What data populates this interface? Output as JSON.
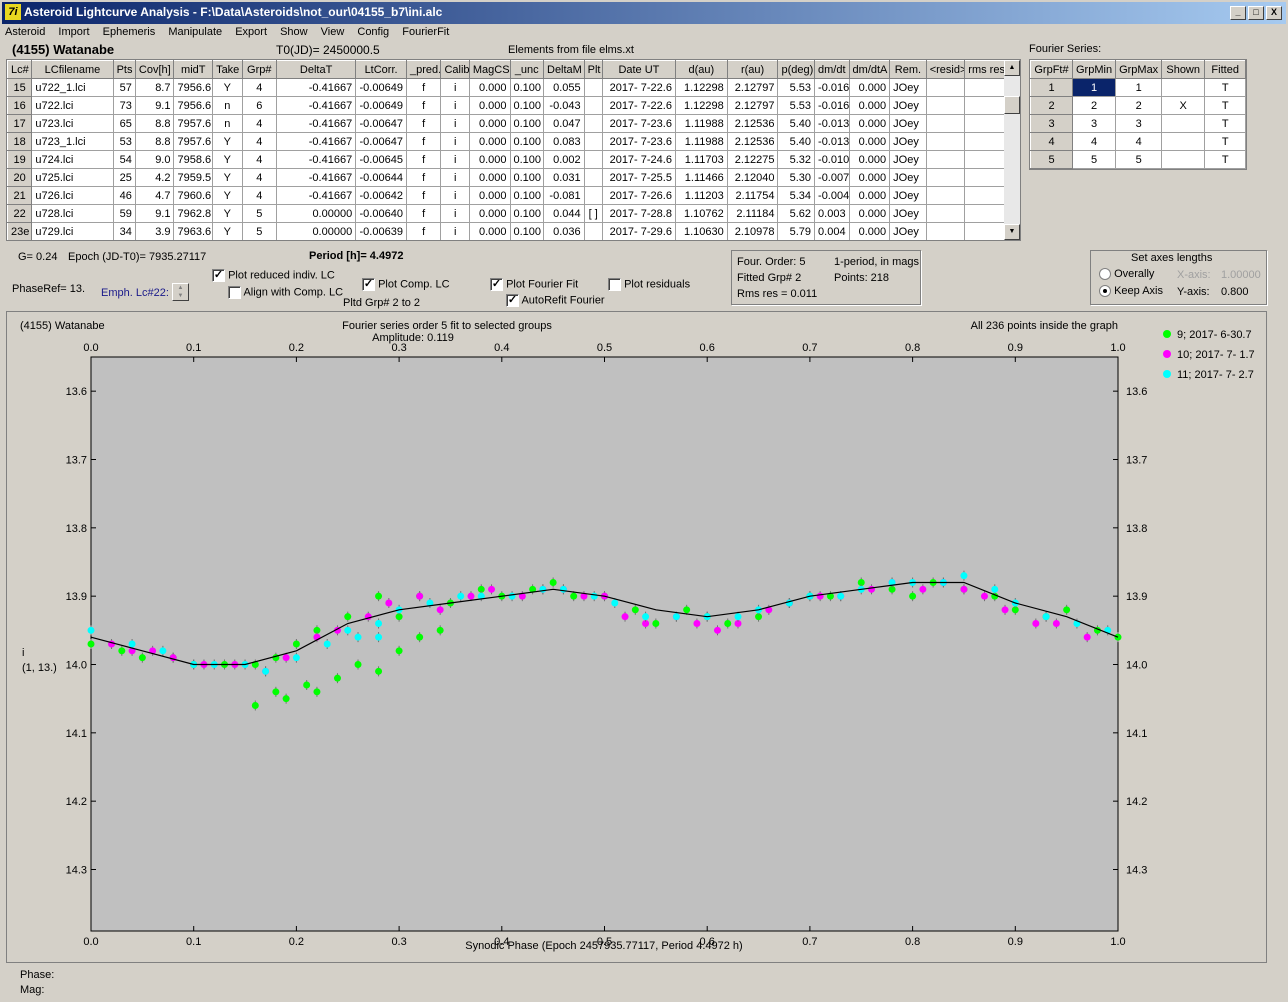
{
  "window": {
    "title": "Asteroid Lightcurve Analysis - F:\\Data\\Asteroids\\not_our\\04155_b7\\ini.alc",
    "icon_text": "7i",
    "min": "_",
    "max": "□",
    "close": "X"
  },
  "menu": [
    "Asteroid",
    "Import",
    "Ephemeris",
    "Manipulate",
    "Export",
    "Show",
    "View",
    "Config",
    "FourierFit"
  ],
  "header": {
    "object": "(4155) Watanabe",
    "t0": "T0(JD)= 2450000.5",
    "elements": "Elements from file elms.xt"
  },
  "lc_table": {
    "columns": [
      "Lc#",
      "LCfilename",
      "Pts",
      "Cov[h]",
      "midT",
      "Take",
      "Grp#",
      "DeltaT",
      "LtCorr.",
      "_pred.",
      "Calib",
      "MagCS",
      "_unc",
      "DeltaM",
      "Plt",
      "Date UT",
      "d(au)",
      "r(au)",
      "p(deg)",
      "dm/dt",
      "dm/dtA",
      "Rem.",
      "<resid>",
      "rms res"
    ],
    "rows": [
      [
        "15",
        "u722_1.lci",
        "57",
        "8.7",
        "7956.6",
        "Y",
        "4",
        "-0.41667",
        "-0.00649",
        "f",
        "i",
        "0.000",
        "0.100",
        "0.055",
        "",
        "2017- 7-22.6",
        "1.12298",
        "2.12797",
        "5.53",
        "-0.016",
        "0.000",
        "JOey",
        "",
        ""
      ],
      [
        "16",
        "u722.lci",
        "73",
        "9.1",
        "7956.6",
        "n",
        "6",
        "-0.41667",
        "-0.00649",
        "f",
        "i",
        "0.000",
        "0.100",
        "-0.043",
        "",
        "2017- 7-22.6",
        "1.12298",
        "2.12797",
        "5.53",
        "-0.016",
        "0.000",
        "JOey",
        "",
        ""
      ],
      [
        "17",
        "u723.lci",
        "65",
        "8.8",
        "7957.6",
        "n",
        "4",
        "-0.41667",
        "-0.00647",
        "f",
        "i",
        "0.000",
        "0.100",
        "0.047",
        "",
        "2017- 7-23.6",
        "1.11988",
        "2.12536",
        "5.40",
        "-0.013",
        "0.000",
        "JOey",
        "",
        ""
      ],
      [
        "18",
        "u723_1.lci",
        "53",
        "8.8",
        "7957.6",
        "Y",
        "4",
        "-0.41667",
        "-0.00647",
        "f",
        "i",
        "0.000",
        "0.100",
        "0.083",
        "",
        "2017- 7-23.6",
        "1.11988",
        "2.12536",
        "5.40",
        "-0.013",
        "0.000",
        "JOey",
        "",
        ""
      ],
      [
        "19",
        "u724.lci",
        "54",
        "9.0",
        "7958.6",
        "Y",
        "4",
        "-0.41667",
        "-0.00645",
        "f",
        "i",
        "0.000",
        "0.100",
        "0.002",
        "",
        "2017- 7-24.6",
        "1.11703",
        "2.12275",
        "5.32",
        "-0.010",
        "0.000",
        "JOey",
        "",
        ""
      ],
      [
        "20",
        "u725.lci",
        "25",
        "4.2",
        "7959.5",
        "Y",
        "4",
        "-0.41667",
        "-0.00644",
        "f",
        "i",
        "0.000",
        "0.100",
        "0.031",
        "",
        "2017- 7-25.5",
        "1.11466",
        "2.12040",
        "5.30",
        "-0.007",
        "0.000",
        "JOey",
        "",
        ""
      ],
      [
        "21",
        "u726.lci",
        "46",
        "4.7",
        "7960.6",
        "Y",
        "4",
        "-0.41667",
        "-0.00642",
        "f",
        "i",
        "0.000",
        "0.100",
        "-0.081",
        "",
        "2017- 7-26.6",
        "1.11203",
        "2.11754",
        "5.34",
        "-0.004",
        "0.000",
        "JOey",
        "",
        ""
      ],
      [
        "22",
        "u728.lci",
        "59",
        "9.1",
        "7962.8",
        "Y",
        "5",
        "0.00000",
        "-0.00640",
        "f",
        "i",
        "0.000",
        "0.100",
        "0.044",
        "[ ]",
        "2017- 7-28.8",
        "1.10762",
        "2.11184",
        "5.62",
        "0.003",
        "0.000",
        "JOey",
        "",
        ""
      ],
      [
        "23e",
        "u729.lci",
        "34",
        "3.9",
        "7963.6",
        "Y",
        "5",
        "0.00000",
        "-0.00639",
        "f",
        "i",
        "0.000",
        "0.100",
        "0.036",
        "",
        "2017- 7-29.6",
        "1.10630",
        "2.10978",
        "5.79",
        "0.004",
        "0.000",
        "JOey",
        "",
        ""
      ]
    ]
  },
  "fourier_table": {
    "label": "Fourier Series:",
    "columns": [
      "GrpFt#",
      "GrpMin",
      "GrpMax",
      "Shown",
      "Fitted"
    ],
    "rows": [
      [
        "1",
        "1",
        "1",
        "",
        "T"
      ],
      [
        "2",
        "2",
        "2",
        "X",
        "T"
      ],
      [
        "3",
        "3",
        "3",
        "",
        "T"
      ],
      [
        "4",
        "4",
        "4",
        "",
        "T"
      ],
      [
        "5",
        "5",
        "5",
        "",
        "T"
      ]
    ]
  },
  "controls": {
    "g": "G= 0.24",
    "epoch": "Epoch (JD-T0)= 7935.27117",
    "period_label": "Period [h]= 4.4972",
    "phaseref": "PhaseRef= 13.",
    "emph": "Emph. Lc#22:",
    "plot_reduced": "Plot reduced indiv. LC",
    "align_comp": "Align with Comp. LC",
    "plot_comp": "Plot Comp. LC",
    "pltd_grp": "Pltd Grp#  2  to   2",
    "plot_fourier": "Plot Fourier Fit",
    "autorefit": "AutoRefit Fourier",
    "plot_residuals": "Plot residuals",
    "check": "✓"
  },
  "fit_info": {
    "order": "Four. Order:  5",
    "period_mode": "1-period, in mags",
    "fitted": "Fitted Grp# 2",
    "points": "Points: 218",
    "rms": "Rms res     = 0.011"
  },
  "axes_box": {
    "title": "Set axes lengths",
    "overally": "Overally",
    "keep": "Keep Axis",
    "xaxis_label": "X-axis:",
    "xaxis_value": "1.00000",
    "yaxis_label": "Y-axis:",
    "yaxis_value": "0.800"
  },
  "plot": {
    "object": "(4155) Watanabe",
    "title": "Fourier series order 5 fit to selected groups",
    "amplitude": "Amplitude: 0.119",
    "inside": "All 236 points inside the graph",
    "ylabel_1": "i",
    "ylabel_2": "(1, 13.)",
    "xlabel": "Synodic Phase (Epoch 2457935.77117, Period 4.4972 h)"
  },
  "chart_data": {
    "type": "scatter",
    "xlim": [
      0,
      1
    ],
    "ylim": [
      13.6,
      14.4
    ],
    "y_inverted": true,
    "x_ticks": [
      "0.0",
      "0.1",
      "0.2",
      "0.3",
      "0.4",
      "0.5",
      "0.6",
      "0.7",
      "0.8",
      "0.9",
      "1.0"
    ],
    "y_ticks": [
      "13.6",
      "13.7",
      "13.8",
      "13.9",
      "14.0",
      "14.1",
      "14.2",
      "14.3"
    ],
    "grid": false,
    "legend_position": "top-right",
    "series": [
      {
        "name": "9; 2017- 6-30.7",
        "color": "#00ff00",
        "x": [
          0.0,
          0.03,
          0.05,
          0.08,
          0.1,
          0.13,
          0.16,
          0.18,
          0.2,
          0.22,
          0.25,
          0.28,
          0.3,
          0.32,
          0.35,
          0.38,
          0.4,
          0.43,
          0.45,
          0.47,
          0.5,
          0.53,
          0.55,
          0.58,
          0.6,
          0.62,
          0.65,
          0.68,
          0.7,
          0.72,
          0.75,
          0.78,
          0.8,
          0.82,
          0.85,
          0.88,
          0.9,
          0.93,
          0.95,
          0.98,
          1.0,
          0.16,
          0.18,
          0.19,
          0.21,
          0.22,
          0.24,
          0.26,
          0.28,
          0.3,
          0.32,
          0.34
        ],
        "y": [
          13.97,
          13.98,
          13.99,
          13.99,
          14.0,
          14.0,
          14.0,
          13.99,
          13.97,
          13.95,
          13.93,
          13.9,
          13.93,
          13.9,
          13.91,
          13.89,
          13.9,
          13.89,
          13.88,
          13.9,
          13.9,
          13.92,
          13.94,
          13.92,
          13.93,
          13.94,
          13.93,
          13.91,
          13.9,
          13.9,
          13.88,
          13.89,
          13.9,
          13.88,
          13.89,
          13.9,
          13.92,
          13.93,
          13.92,
          13.95,
          13.96,
          14.06,
          14.04,
          14.05,
          14.03,
          14.04,
          14.02,
          14.0,
          14.01,
          13.98,
          13.96,
          13.95
        ]
      },
      {
        "name": "10; 2017- 7- 1.7",
        "color": "#ff00ff",
        "x": [
          0.02,
          0.04,
          0.06,
          0.08,
          0.11,
          0.14,
          0.17,
          0.19,
          0.22,
          0.24,
          0.27,
          0.29,
          0.32,
          0.34,
          0.37,
          0.39,
          0.42,
          0.44,
          0.46,
          0.48,
          0.5,
          0.52,
          0.54,
          0.57,
          0.59,
          0.61,
          0.63,
          0.66,
          0.68,
          0.71,
          0.73,
          0.76,
          0.78,
          0.81,
          0.83,
          0.85,
          0.87,
          0.89,
          0.92,
          0.94,
          0.97
        ],
        "y": [
          13.97,
          13.98,
          13.98,
          13.99,
          14.0,
          14.0,
          14.01,
          13.99,
          13.96,
          13.95,
          13.93,
          13.91,
          13.9,
          13.92,
          13.9,
          13.89,
          13.9,
          13.89,
          13.89,
          13.9,
          13.9,
          13.93,
          13.94,
          13.93,
          13.94,
          13.95,
          13.94,
          13.92,
          13.91,
          13.9,
          13.9,
          13.89,
          13.88,
          13.89,
          13.88,
          13.89,
          13.9,
          13.92,
          13.94,
          13.94,
          13.96
        ]
      },
      {
        "name": "11; 2017- 7- 2.7",
        "color": "#00ffff",
        "x": [
          0.0,
          0.04,
          0.07,
          0.1,
          0.12,
          0.15,
          0.17,
          0.2,
          0.23,
          0.25,
          0.28,
          0.3,
          0.33,
          0.36,
          0.38,
          0.41,
          0.44,
          0.46,
          0.49,
          0.51,
          0.54,
          0.57,
          0.6,
          0.63,
          0.65,
          0.68,
          0.7,
          0.73,
          0.75,
          0.78,
          0.8,
          0.83,
          0.85,
          0.88,
          0.9,
          0.93,
          0.96,
          0.99,
          0.26,
          0.28
        ],
        "y": [
          13.95,
          13.97,
          13.98,
          14.0,
          14.0,
          14.0,
          14.01,
          13.99,
          13.97,
          13.95,
          13.94,
          13.92,
          13.91,
          13.9,
          13.9,
          13.9,
          13.89,
          13.89,
          13.9,
          13.91,
          13.93,
          13.93,
          13.93,
          13.93,
          13.92,
          13.91,
          13.9,
          13.9,
          13.89,
          13.88,
          13.88,
          13.88,
          13.87,
          13.89,
          13.91,
          13.93,
          13.94,
          13.95,
          13.96,
          13.96
        ]
      }
    ],
    "fit_curve": {
      "x": [
        0.0,
        0.05,
        0.1,
        0.15,
        0.2,
        0.25,
        0.3,
        0.35,
        0.4,
        0.45,
        0.5,
        0.55,
        0.6,
        0.65,
        0.7,
        0.75,
        0.8,
        0.85,
        0.9,
        0.95,
        1.0
      ],
      "y": [
        13.96,
        13.98,
        14.0,
        14.0,
        13.98,
        13.94,
        13.92,
        13.91,
        13.9,
        13.89,
        13.9,
        13.92,
        13.93,
        13.92,
        13.9,
        13.89,
        13.88,
        13.88,
        13.91,
        13.93,
        13.96
      ]
    }
  },
  "footer": {
    "phase": "Phase:",
    "mag": "Mag:"
  }
}
